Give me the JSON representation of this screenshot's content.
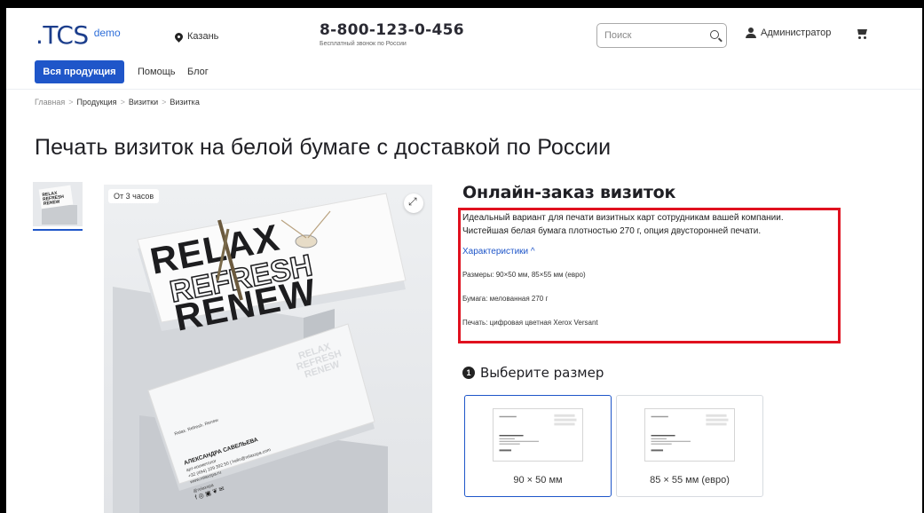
{
  "header": {
    "logo": ".TCS",
    "logo_suffix": "demo",
    "city": "Казань",
    "phone": "8-800-123-0-456",
    "phone_note": "Бесплатный звонок по России",
    "search_placeholder": "Поиск",
    "user": "Администратор"
  },
  "nav": {
    "items": [
      {
        "label": "Вся продукция",
        "active": true
      },
      {
        "label": "Помощь",
        "active": false
      },
      {
        "label": "Блог",
        "active": false
      }
    ]
  },
  "breadcrumb": [
    "Главная",
    "Продукция",
    "Визитки",
    "Визитка"
  ],
  "breadcrumb_sep": ">",
  "page_title": "Печать визиток на белой бумаге с доставкой по России",
  "gallery": {
    "badge": "От 3 часов",
    "image_text": [
      "RELAX",
      "REFRESH",
      "RENEW"
    ],
    "card_name": "АЛЕКСАНДРА САВЕЛЬЕВА",
    "card_role": "арт-косметолог",
    "card_contact": "+32 (494) 109 392 50 | hello@relaxspa.com",
    "card_site": "www.relaxspa.ru",
    "card_tagline": "Relax. Refresh. Renew",
    "card_handle": "@relaxspa"
  },
  "product": {
    "heading": "Онлайн-заказ визиток",
    "description_line1": "Идеальный вариант для печати визитных карт сотрудникам вашей компании.",
    "description_line2": "Чистейшая белая бумага плотностью 270 г, опция двусторонней печати.",
    "characteristics_link": "Характеристики ^",
    "specs": [
      "Размеры: 90×50 мм, 85×55 мм (евро)",
      "Бумага: мелованная 270 г",
      "Печать: цифровая цветная Xerox Versant"
    ],
    "highlight_color": "#e0111f"
  },
  "size_step": {
    "number": "1",
    "label": "Выберите размер",
    "options": [
      {
        "label": "90 × 50 мм",
        "selected": true
      },
      {
        "label": "85 × 55 мм (евро)",
        "selected": false
      }
    ]
  },
  "colors": {
    "accent": "#1f56c9",
    "brand": "#1c3e8c"
  }
}
